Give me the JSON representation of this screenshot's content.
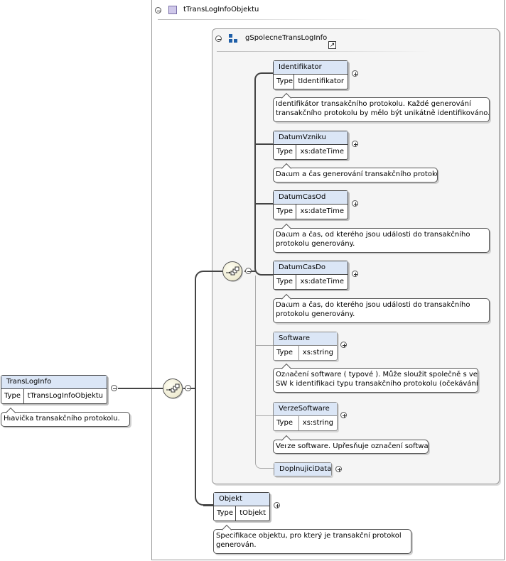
{
  "complex_type": {
    "title": "tTransLogInfoObjektu"
  },
  "group": {
    "title": "gSpolecneTransLogInfo"
  },
  "type_label": "Type",
  "root": {
    "name": "TransLogInfo",
    "type": "tTransLogInfoObjektu",
    "doc": "Hlavička transakčního protokolu."
  },
  "elements": [
    {
      "name": "Identifikator",
      "type": "tIdentifikator",
      "optional": false,
      "doc": [
        "Identifikátor transakčního protokolu. Každé generování",
        "transakčního protokolu by mělo být unikátně identifikováno...."
      ]
    },
    {
      "name": "DatumVzniku",
      "type": "xs:dateTime",
      "optional": false,
      "doc": [
        "Datum a čas generování transakčního protokolu."
      ]
    },
    {
      "name": "DatumCasOd",
      "type": "xs:dateTime",
      "optional": false,
      "doc": [
        "Datum a čas, od kterého jsou události do transakčního",
        "protokolu generovány."
      ]
    },
    {
      "name": "DatumCasDo",
      "type": "xs:dateTime",
      "optional": false,
      "doc": [
        "Datum a čas, do kterého jsou události do transakčního",
        "protokolu generovány."
      ]
    },
    {
      "name": "Software",
      "type": "xs:string",
      "optional": true,
      "doc": [
        "Označení software ( typové ). Může sloužit společně s verzí",
        "SW k identifikaci typu transakčního protokolu (očekávání..."
      ]
    },
    {
      "name": "VerzeSoftware",
      "type": "xs:string",
      "optional": true,
      "doc": [
        "Verze software. Upřesňuje označení software."
      ]
    },
    {
      "name": "DoplnujiciData",
      "optional": true
    }
  ],
  "objekt": {
    "name": "Objekt",
    "type": "tObjekt",
    "doc": [
      "Specifikace objektu, pro který je transakční protokol",
      "generován."
    ]
  },
  "icons": {
    "complex_type": "complex-type-icon",
    "group": "group-icon",
    "group_link": "group-link-arrow-icon",
    "sequence": "sequence-compositor-icon"
  }
}
